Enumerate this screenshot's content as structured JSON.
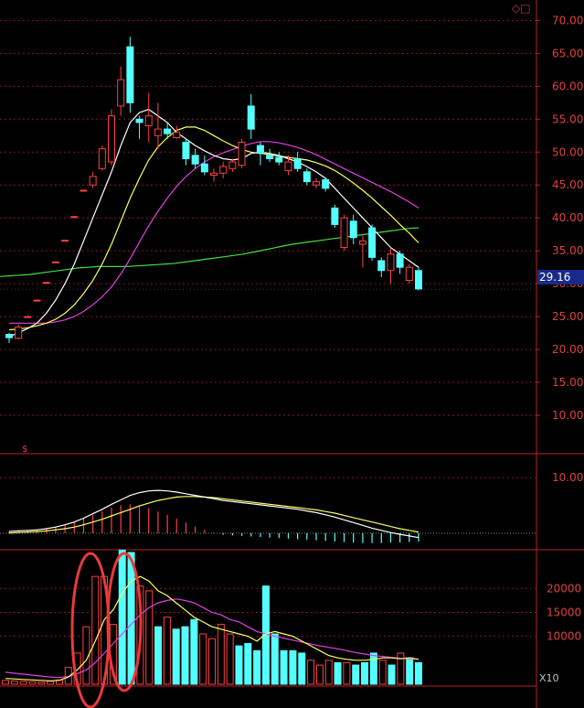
{
  "price_tag": "29.16",
  "x10_label": "X10",
  "top_marker": "◇□",
  "chart_data": [
    {
      "type": "candlestick",
      "yticks": [
        "70.00",
        "65.00",
        "60.00",
        "55.00",
        "50.00",
        "45.00",
        "40.00",
        "35.00",
        "30.00",
        "25.00",
        "20.00",
        "15.00",
        "10.00"
      ],
      "ytick_values": [
        70,
        65,
        60,
        55,
        50,
        45,
        40,
        35,
        30,
        25,
        20,
        15,
        10
      ],
      "ylim": [
        5,
        72
      ],
      "last_price": 29.16,
      "candles": [
        {
          "o": 21.8,
          "h": 22.5,
          "l": 21.0,
          "c": 22.3,
          "up": false
        },
        {
          "o": 21.7,
          "h": 23.8,
          "l": 21.5,
          "c": 23.4,
          "up": true
        },
        {
          "o": 25.0,
          "h": 25.2,
          "l": 24.8,
          "c": 25.0,
          "up": true
        },
        {
          "o": 27.5,
          "h": 27.6,
          "l": 27.4,
          "c": 27.5,
          "up": true
        },
        {
          "o": 30.2,
          "h": 30.3,
          "l": 30.1,
          "c": 30.2,
          "up": true
        },
        {
          "o": 33.3,
          "h": 33.4,
          "l": 33.2,
          "c": 33.3,
          "up": true
        },
        {
          "o": 36.6,
          "h": 36.7,
          "l": 36.5,
          "c": 36.6,
          "up": true
        },
        {
          "o": 40.2,
          "h": 40.3,
          "l": 40.1,
          "c": 40.2,
          "up": true
        },
        {
          "o": 44.2,
          "h": 44.3,
          "l": 44.1,
          "c": 44.2,
          "up": true
        },
        {
          "o": 45.0,
          "h": 47.0,
          "l": 44.5,
          "c": 46.3,
          "up": true
        },
        {
          "o": 47.5,
          "h": 51.0,
          "l": 47.2,
          "c": 50.5,
          "up": true
        },
        {
          "o": 48.5,
          "h": 56.5,
          "l": 48.0,
          "c": 55.5,
          "up": true
        },
        {
          "o": 57.0,
          "h": 63.0,
          "l": 55.5,
          "c": 61.0,
          "up": true
        },
        {
          "o": 66.0,
          "h": 67.5,
          "l": 56.0,
          "c": 57.5,
          "up": false
        },
        {
          "o": 55.0,
          "h": 55.5,
          "l": 52.0,
          "c": 54.5,
          "up": false
        },
        {
          "o": 55.5,
          "h": 59.0,
          "l": 51.5,
          "c": 54.0,
          "up": true
        },
        {
          "o": 52.5,
          "h": 57.5,
          "l": 50.5,
          "c": 53.5,
          "up": true
        },
        {
          "o": 53.5,
          "h": 54.5,
          "l": 52.0,
          "c": 52.8,
          "up": false
        },
        {
          "o": 53.0,
          "h": 54.0,
          "l": 52.0,
          "c": 52.2,
          "up": true
        },
        {
          "o": 51.5,
          "h": 52.0,
          "l": 48.0,
          "c": 49.0,
          "up": false
        },
        {
          "o": 49.5,
          "h": 50.5,
          "l": 47.5,
          "c": 48.2,
          "up": false
        },
        {
          "o": 48.2,
          "h": 49.5,
          "l": 46.5,
          "c": 47.0,
          "up": false
        },
        {
          "o": 46.8,
          "h": 47.5,
          "l": 45.5,
          "c": 46.5,
          "up": true
        },
        {
          "o": 46.8,
          "h": 48.5,
          "l": 46.0,
          "c": 47.8,
          "up": true
        },
        {
          "o": 47.5,
          "h": 49.0,
          "l": 47.0,
          "c": 48.5,
          "up": true
        },
        {
          "o": 48.0,
          "h": 52.0,
          "l": 47.5,
          "c": 51.5,
          "up": true
        },
        {
          "o": 53.5,
          "h": 58.8,
          "l": 52.0,
          "c": 57.0,
          "up": false
        },
        {
          "o": 51.0,
          "h": 51.5,
          "l": 48.0,
          "c": 49.8,
          "up": false
        },
        {
          "o": 49.5,
          "h": 50.5,
          "l": 48.5,
          "c": 49.0,
          "up": false
        },
        {
          "o": 49.2,
          "h": 50.0,
          "l": 48.0,
          "c": 48.5,
          "up": false
        },
        {
          "o": 48.5,
          "h": 49.5,
          "l": 46.5,
          "c": 47.2,
          "up": true
        },
        {
          "o": 49.0,
          "h": 50.0,
          "l": 47.0,
          "c": 47.5,
          "up": false
        },
        {
          "o": 47.0,
          "h": 47.5,
          "l": 45.0,
          "c": 45.5,
          "up": false
        },
        {
          "o": 45.5,
          "h": 46.0,
          "l": 44.5,
          "c": 45.0,
          "up": true
        },
        {
          "o": 45.8,
          "h": 46.2,
          "l": 44.0,
          "c": 44.5,
          "up": false
        },
        {
          "o": 41.5,
          "h": 42.0,
          "l": 38.5,
          "c": 39.0,
          "up": false
        },
        {
          "o": 35.5,
          "h": 40.5,
          "l": 35.0,
          "c": 40.0,
          "up": true
        },
        {
          "o": 39.5,
          "h": 40.5,
          "l": 36.0,
          "c": 37.0,
          "up": false
        },
        {
          "o": 36.5,
          "h": 37.5,
          "l": 32.5,
          "c": 36.0,
          "up": true
        },
        {
          "o": 38.5,
          "h": 39.0,
          "l": 33.5,
          "c": 34.0,
          "up": false
        },
        {
          "o": 33.5,
          "h": 34.0,
          "l": 31.0,
          "c": 32.0,
          "up": false
        },
        {
          "o": 34.5,
          "h": 35.5,
          "l": 30.0,
          "c": 32.0,
          "up": true
        },
        {
          "o": 34.5,
          "h": 35.0,
          "l": 31.5,
          "c": 32.5,
          "up": false
        },
        {
          "o": 32.5,
          "h": 33.0,
          "l": 30.0,
          "c": 30.5,
          "up": true
        },
        {
          "o": 32.0,
          "h": 32.5,
          "l": 29.0,
          "c": 29.2,
          "up": false
        }
      ],
      "ma5": [
        22,
        22.5,
        23.2,
        24,
        25.5,
        27.5,
        30,
        33,
        36.5,
        40,
        43.5,
        47,
        51,
        54.5,
        56,
        56.5,
        55.5,
        54.5,
        53,
        52,
        51,
        50.2,
        49.5,
        49,
        48.8,
        49,
        49.8,
        50,
        49.8,
        49.5,
        49,
        48.5,
        47.8,
        47,
        46,
        44.5,
        43,
        41.5,
        40,
        38.5,
        37,
        35.5,
        34.5,
        33.5,
        32.5
      ],
      "ma10": [
        23,
        23.1,
        23.3,
        23.6,
        24,
        24.6,
        25.5,
        26.8,
        28.5,
        30.5,
        33,
        36,
        39.5,
        43,
        46,
        48.8,
        50.8,
        52.2,
        53.3,
        53.8,
        53.8,
        53.3,
        52.5,
        51.7,
        51,
        50.4,
        50,
        49.8,
        49.6,
        49.4,
        49.2,
        49,
        48.8,
        48.4,
        47.9,
        47.2,
        46.3,
        45.3,
        44.2,
        43,
        41.7,
        40.4,
        39,
        37.7,
        36.2
      ],
      "ma20": [
        24,
        24,
        24,
        24,
        24,
        24.2,
        24.5,
        25,
        25.8,
        26.8,
        28,
        29.5,
        31.5,
        33.8,
        36.3,
        38.8,
        41,
        43,
        44.8,
        46.3,
        47.5,
        48.5,
        49.3,
        49.9,
        50.4,
        50.9,
        51.3,
        51.6,
        51.6,
        51.4,
        51.1,
        50.7,
        50.2,
        49.6,
        48.9,
        48.2,
        47.5,
        46.8,
        46.1,
        45.4,
        44.7,
        44,
        43.2,
        42.4,
        41.5
      ],
      "ma60": [
        31,
        31.1,
        31.2,
        31.3,
        31.4,
        31.6,
        31.8,
        32,
        32.2,
        32.4,
        32.5,
        32.6,
        32.6,
        32.6,
        32.6,
        32.7,
        32.8,
        32.9,
        33,
        33.1,
        33.3,
        33.5,
        33.7,
        33.9,
        34.1,
        34.3,
        34.5,
        34.8,
        35.1,
        35.4,
        35.7,
        36,
        36.2,
        36.4,
        36.6,
        36.8,
        37,
        37.2,
        37.4,
        37.6,
        37.8,
        38,
        38.2,
        38.4,
        38.5
      ]
    },
    {
      "type": "macd",
      "yticks": [
        "10.00"
      ],
      "ytick_values": [
        10
      ],
      "ylim": [
        -2.5,
        13
      ],
      "hist": [
        0.3,
        0.4,
        0.5,
        0.6,
        0.8,
        1.1,
        1.5,
        2.0,
        2.6,
        3.3,
        4.0,
        4.6,
        5.0,
        5.2,
        5.0,
        4.5,
        3.9,
        3.3,
        2.6,
        1.9,
        1.2,
        0.6,
        0.1,
        -0.3,
        -0.4,
        -0.5,
        -0.6,
        -0.7,
        -0.8,
        -0.9,
        -1.0,
        -1.1,
        -1.2,
        -1.3,
        -1.4,
        -1.5,
        -1.6,
        -1.7,
        -1.8,
        -1.8,
        -1.8,
        -1.7,
        -1.7,
        -1.6,
        -1.5
      ],
      "dif": [
        0.3,
        0.4,
        0.5,
        0.6,
        0.8,
        1.1,
        1.5,
        2.0,
        2.7,
        3.5,
        4.3,
        5.2,
        6.0,
        6.8,
        7.3,
        7.6,
        7.7,
        7.6,
        7.4,
        7.1,
        6.8,
        6.5,
        6.2,
        5.9,
        5.7,
        5.5,
        5.3,
        5.1,
        4.9,
        4.7,
        4.5,
        4.3,
        4.0,
        3.7,
        3.3,
        2.9,
        2.4,
        1.9,
        1.4,
        0.9,
        0.5,
        0.1,
        -0.2,
        -0.5,
        -0.8
      ],
      "dea": [
        0.0,
        0.1,
        0.2,
        0.3,
        0.4,
        0.6,
        0.8,
        1.1,
        1.5,
        2.0,
        2.5,
        3.1,
        3.7,
        4.3,
        4.9,
        5.4,
        5.9,
        6.2,
        6.5,
        6.6,
        6.6,
        6.5,
        6.4,
        6.2,
        6.0,
        5.8,
        5.6,
        5.4,
        5.2,
        5.0,
        4.8,
        4.6,
        4.4,
        4.2,
        3.9,
        3.6,
        3.2,
        2.8,
        2.4,
        2.0,
        1.6,
        1.2,
        0.8,
        0.5,
        0.2
      ]
    },
    {
      "type": "volume",
      "yticks": [
        "20000",
        "15000",
        "10000"
      ],
      "ytick_values": [
        20000,
        15000,
        10000
      ],
      "ylim": [
        0,
        27500
      ],
      "volumes": [
        800,
        700,
        600,
        500,
        400,
        600,
        900,
        3500,
        6500,
        12000,
        22500,
        22500,
        12500,
        28000,
        27500,
        20500,
        19500,
        12000,
        14000,
        11500,
        12000,
        13500,
        10500,
        9500,
        12500,
        10500,
        8000,
        8500,
        7000,
        20500,
        10500,
        7000,
        7000,
        6500,
        5000,
        4000,
        5000,
        4500,
        4500,
        4000,
        4500,
        6500,
        5000,
        4000,
        6500,
        5500,
        4500
      ],
      "up": [
        true,
        true,
        true,
        true,
        true,
        true,
        true,
        true,
        true,
        true,
        true,
        true,
        true,
        false,
        false,
        true,
        true,
        false,
        true,
        false,
        false,
        false,
        true,
        true,
        true,
        true,
        false,
        false,
        false,
        false,
        false,
        false,
        false,
        false,
        true,
        true,
        true,
        false,
        true,
        false,
        false,
        false,
        true,
        false,
        true,
        false,
        false
      ],
      "vma5": [
        1200,
        1100,
        1000,
        900,
        800,
        700,
        800,
        1500,
        3000,
        5000,
        9000,
        13500,
        15500,
        19000,
        21500,
        22500,
        21500,
        19500,
        18500,
        17000,
        15500,
        14000,
        13000,
        12000,
        11500,
        11000,
        10500,
        10000,
        9000,
        10500,
        11000,
        10500,
        10000,
        9000,
        8000,
        7000,
        6000,
        5500,
        5200,
        5000,
        5000,
        5200,
        5500,
        5500,
        5300,
        5500,
        5200
      ],
      "vma10": [
        2500,
        2300,
        2100,
        1900,
        1700,
        1500,
        1400,
        1600,
        2200,
        3000,
        4500,
        6500,
        8500,
        10500,
        12500,
        14500,
        16000,
        17000,
        17500,
        17800,
        17500,
        17000,
        16000,
        15000,
        14500,
        13500,
        13000,
        12000,
        11000,
        10500,
        10000,
        9600,
        9200,
        8800,
        8400,
        8000,
        7700,
        7400,
        7000,
        6600,
        6300,
        6000,
        5800,
        5600,
        5400,
        5300,
        5200
      ]
    }
  ]
}
